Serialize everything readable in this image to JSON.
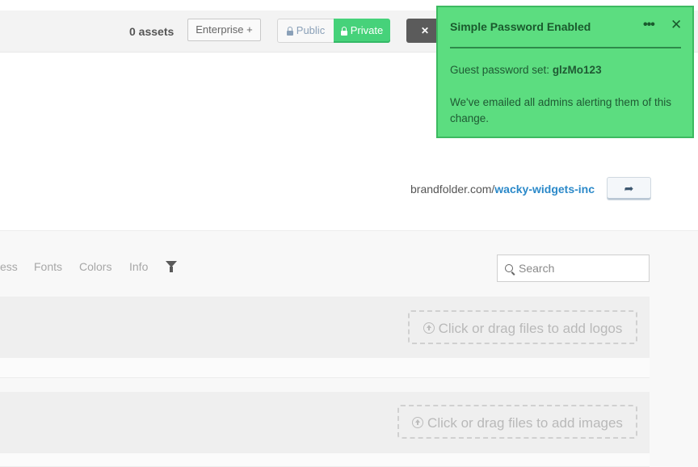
{
  "header": {
    "assets_count": "0 assets",
    "plan_button": "Enterprise +",
    "privacy": {
      "public_label": "Public",
      "private_label": "Private",
      "selected": "Private"
    },
    "fullscreen_label": ""
  },
  "share": {
    "url_prefix": "brandfolder.com/",
    "url_slug": "wacky-widgets-inc"
  },
  "nav": {
    "items": [
      "ess",
      "Fonts",
      "Colors",
      "Info"
    ]
  },
  "search": {
    "placeholder": "Search"
  },
  "sections": [
    {
      "dropzone_label": "Click or drag files to add logos"
    },
    {
      "dropzone_label": "Click or drag files to add images"
    }
  ],
  "toast": {
    "title": "Simple Password Enabled",
    "guest_label": "Guest password set: ",
    "password": "glzMo123",
    "message": "We've emailed all admins alerting them of this change.",
    "color": "#5cdd80"
  }
}
